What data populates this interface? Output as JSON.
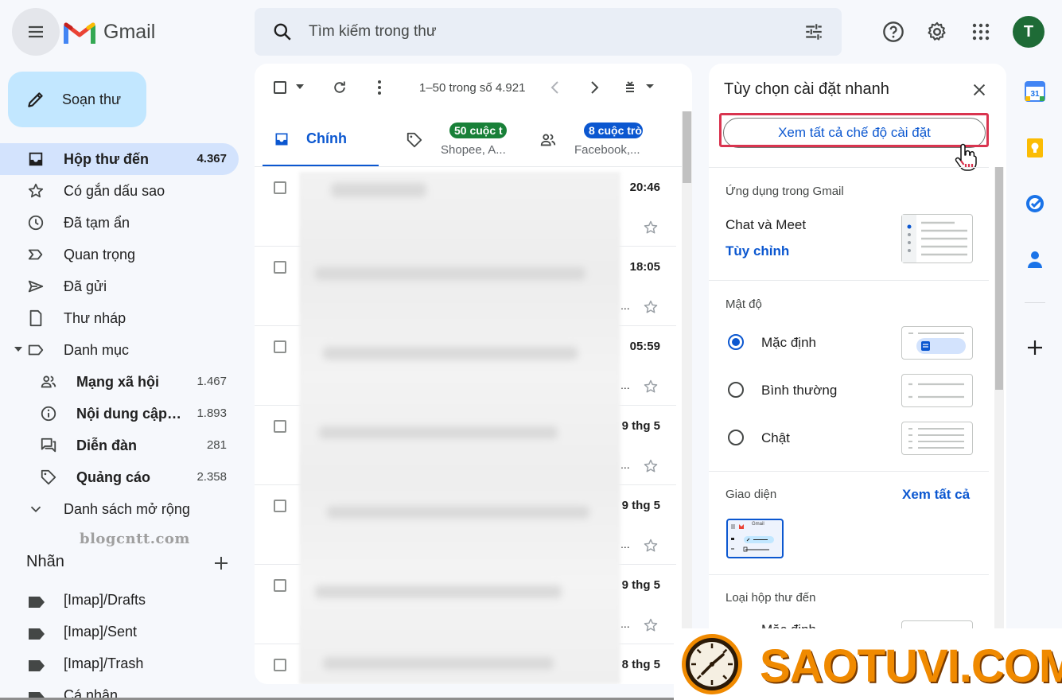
{
  "app": {
    "logo_text": "Gmail",
    "avatar_letter": "T",
    "colors": {
      "accent": "#0b57d0",
      "compose_bg": "#c2e7ff",
      "active_nav": "#d3e3fd",
      "avatar_bg": "#1e6b36",
      "highlight": "#d9344f",
      "watermark": "#f08a00"
    }
  },
  "search": {
    "placeholder": "Tìm kiếm trong thư"
  },
  "compose": {
    "label": "Soạn thư"
  },
  "nav": [
    {
      "label": "Hộp thư đến",
      "count": "4.367",
      "icon": "inbox-icon"
    },
    {
      "label": "Có gắn dấu sao",
      "count": "",
      "icon": "star-icon"
    },
    {
      "label": "Đã tạm ẩn",
      "count": "",
      "icon": "clock-icon"
    },
    {
      "label": "Quan trọng",
      "count": "",
      "icon": "important-icon"
    },
    {
      "label": "Đã gửi",
      "count": "",
      "icon": "send-icon"
    },
    {
      "label": "Thư nháp",
      "count": "",
      "icon": "file-icon"
    },
    {
      "label": "Danh mục",
      "count": "",
      "icon": "label-outline-icon"
    }
  ],
  "categories": [
    {
      "label": "Mạng xã hội",
      "count": "1.467",
      "icon": "people-icon"
    },
    {
      "label": "Nội dung cập nhật",
      "count": "1.893",
      "icon": "info-icon"
    },
    {
      "label": "Diễn đàn",
      "count": "281",
      "icon": "forum-icon"
    },
    {
      "label": "Quảng cáo",
      "count": "2.358",
      "icon": "tag-icon"
    }
  ],
  "expand": {
    "label": "Danh sách mở rộng"
  },
  "sidebar_watermark": "blogcntt.com",
  "labels": {
    "title": "Nhãn",
    "items": [
      "[Imap]/Drafts",
      "[Imap]/Sent",
      "[Imap]/Trash",
      "Cá nhân"
    ]
  },
  "mail": {
    "pager": "1–50 trong số 4.921",
    "tabs": {
      "main": "Chính",
      "promo_badge": "50 cuộc t",
      "promo_sub": "Shopee, A...",
      "social_badge": "8 cuộc trò",
      "social_sub": "Facebook,..."
    },
    "rows": [
      {
        "time": "20:46",
        "dots": ""
      },
      {
        "time": "18:05",
        "dots": "..."
      },
      {
        "time": "05:59",
        "dots": "..."
      },
      {
        "time": "9 thg 5",
        "dots": "..."
      },
      {
        "time": "9 thg 5",
        "dots": "..."
      },
      {
        "time": "9 thg 5",
        "dots": "..."
      },
      {
        "time": "8 thg 5",
        "dots": ""
      }
    ]
  },
  "quick_settings": {
    "title": "Tùy chọn cài đặt nhanh",
    "all_settings_button": "Xem tất cả chế độ cài đặt",
    "apps_section": "Ứng dụng trong Gmail",
    "chat_meet": "Chat và Meet",
    "customize": "Tùy chỉnh",
    "density_section": "Mật độ",
    "density_options": [
      "Mặc định",
      "Bình thường",
      "Chật"
    ],
    "density_selected": "Mặc định",
    "theme_section": "Giao diện",
    "theme_see_all": "Xem tất cả",
    "theme_thumb_logo": "Gmail",
    "inbox_type_section": "Loại hộp thư đến",
    "inbox_type_first": "Mặc định"
  },
  "bottom_watermark": "SAOTUVI.COM"
}
